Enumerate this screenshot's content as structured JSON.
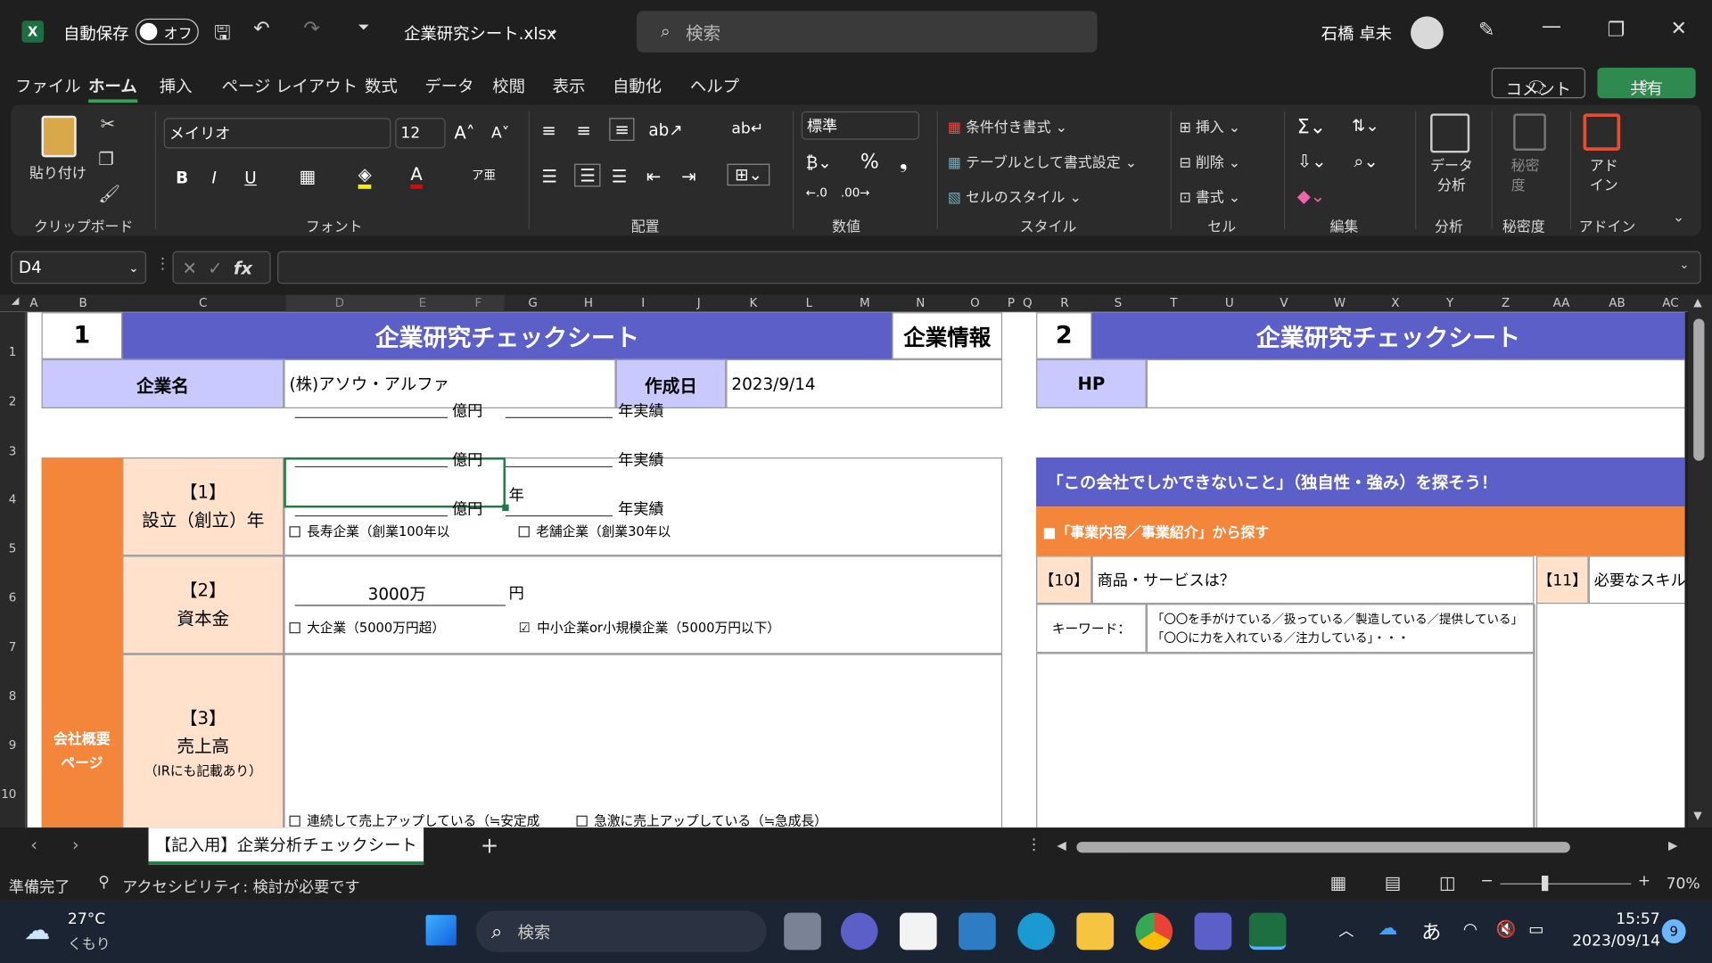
{
  "titlebar": {
    "autosave": "自動保存",
    "toggle": "オフ",
    "filename": "企業研究シート.xlsx",
    "search": "検索",
    "user": "石橋 卓未"
  },
  "menu": [
    "ファイル",
    "ホーム",
    "挿入",
    "ページ レイアウト",
    "数式",
    "データ",
    "校閲",
    "表示",
    "自動化",
    "ヘルプ"
  ],
  "comment_btn": "コメント",
  "share_btn": "共有",
  "ribbon": {
    "paste": "貼り付け",
    "clipboard": "クリップボード",
    "font_name": "メイリオ",
    "font_size": "12",
    "font": "フォント",
    "align": "配置",
    "numfmt": "標準",
    "number": "数値",
    "cond": "条件付き書式",
    "table": "テーブルとして書式設定",
    "cellstyle": "セルのスタイル",
    "style": "スタイル",
    "insert": "挿入",
    "delete": "削除",
    "format": "書式",
    "cell": "セル",
    "edit": "編集",
    "data_analysis": "データ\n分析",
    "analysis": "分析",
    "sens": "秘密\n度",
    "sensitivity": "秘密度",
    "addin": "アド\nイン",
    "addins": "アドイン"
  },
  "formula": {
    "namebox": "D4",
    "fx": "fx"
  },
  "cols": [
    "A",
    "B",
    "C",
    "D",
    "E",
    "F",
    "G",
    "H",
    "I",
    "J",
    "K",
    "L",
    "M",
    "N",
    "O",
    "P",
    "Q",
    "R",
    "S",
    "T",
    "U",
    "V",
    "W",
    "X",
    "Y",
    "Z",
    "AA",
    "AB",
    "AC"
  ],
  "rows": [
    "1",
    "2",
    "3",
    "4",
    "5",
    "6",
    "7",
    "8",
    "9",
    "10"
  ],
  "sheet": {
    "n1": "1",
    "title1": "企業研究チェックシート",
    "info": "企業情報",
    "name_lbl": "企業名",
    "name_val": "(株)アソウ・アルファ",
    "date_lbl": "作成日",
    "date_val": "2023/9/14",
    "side": "会社概要\nページ",
    "q1": "【1】\n設立（創立）年",
    "q1_unit": "年",
    "q1_a": "長寿企業（創業100年以",
    "q1_b": "老舗企業（創業30年以",
    "q2": "【2】\n資本金",
    "q2_val": "3000万",
    "q2_unit": "円",
    "q2_a": "大企業（5000万円超）",
    "q2_b": "中小企業or小規模企業（5000万円以下）",
    "q2_check": "☑",
    "q3": "【3】\n売上高",
    "q3_sub": "（IRにも記載あり）",
    "oku": "億円",
    "jisseki": "年実績",
    "q3_a": "連続して売上アップしている（≒安定成",
    "q3_b": "急激に売上アップしている（≒急成長）",
    "n2": "2",
    "title2": "企業研究チェックシート",
    "hp": "HP",
    "banner": "「この会社でしかできないこと」（独自性・強み）を探そう！",
    "sub": "■「事業内容／事業紹介」から探す",
    "q10n": "【10】",
    "q10": "商品・サービスは？",
    "q11n": "【11】",
    "q11": "必要なスキル",
    "kw": "キーワード：",
    "kw_text": "「〇〇を手がけている／扱っている／製造している／提供している」「〇〇に力を入れている／注力している」・・・"
  },
  "tab": "【記入用】企業分析チェックシート",
  "status": {
    "ready": "準備完了",
    "access": "アクセシビリティ: 検討が必要です",
    "zoom": "70%"
  },
  "taskbar": {
    "temp": "27°C",
    "weather": "くもり",
    "search": "検索",
    "ime": "あ",
    "time": "15:57",
    "date": "2023/09/14",
    "badge": "9"
  }
}
